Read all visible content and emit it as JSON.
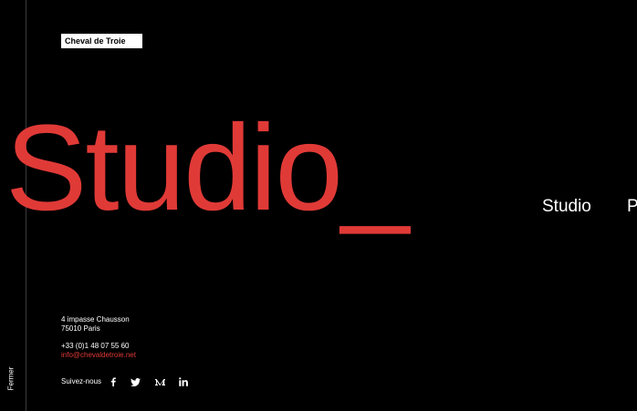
{
  "brand": {
    "logo_text": "Cheval de Troie"
  },
  "hero": {
    "title": "Studio_",
    "accent_color": "#e03a37"
  },
  "nav": {
    "items": [
      {
        "label": "Studio"
      },
      {
        "label": "P"
      }
    ]
  },
  "sidebar": {
    "close_label": "Fermer"
  },
  "contact": {
    "address_line1": "4 impasse Chausson",
    "address_line2": "75010 Paris",
    "phone": "+33 (0)1 48 07 55 60",
    "email": "info@chevaldetroie.net"
  },
  "social": {
    "label": "Suivez-nous",
    "icons": [
      "facebook-icon",
      "twitter-icon",
      "medium-icon",
      "linkedin-icon"
    ]
  }
}
